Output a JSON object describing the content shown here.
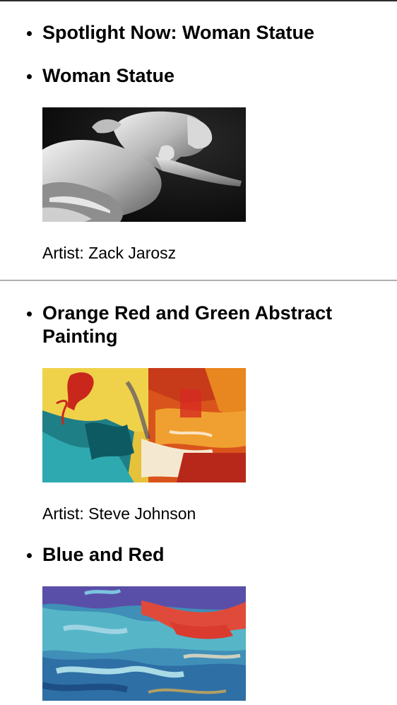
{
  "spotlight": {
    "heading": "Spotlight Now: Woman Statue",
    "title": "Woman Statue",
    "artist": "Artist: Zack Jarosz"
  },
  "artworks": [
    {
      "title": "Orange Red and Green Abstract Painting",
      "artist": "Artist: Steve Johnson"
    },
    {
      "title": "Blue and Red"
    }
  ]
}
